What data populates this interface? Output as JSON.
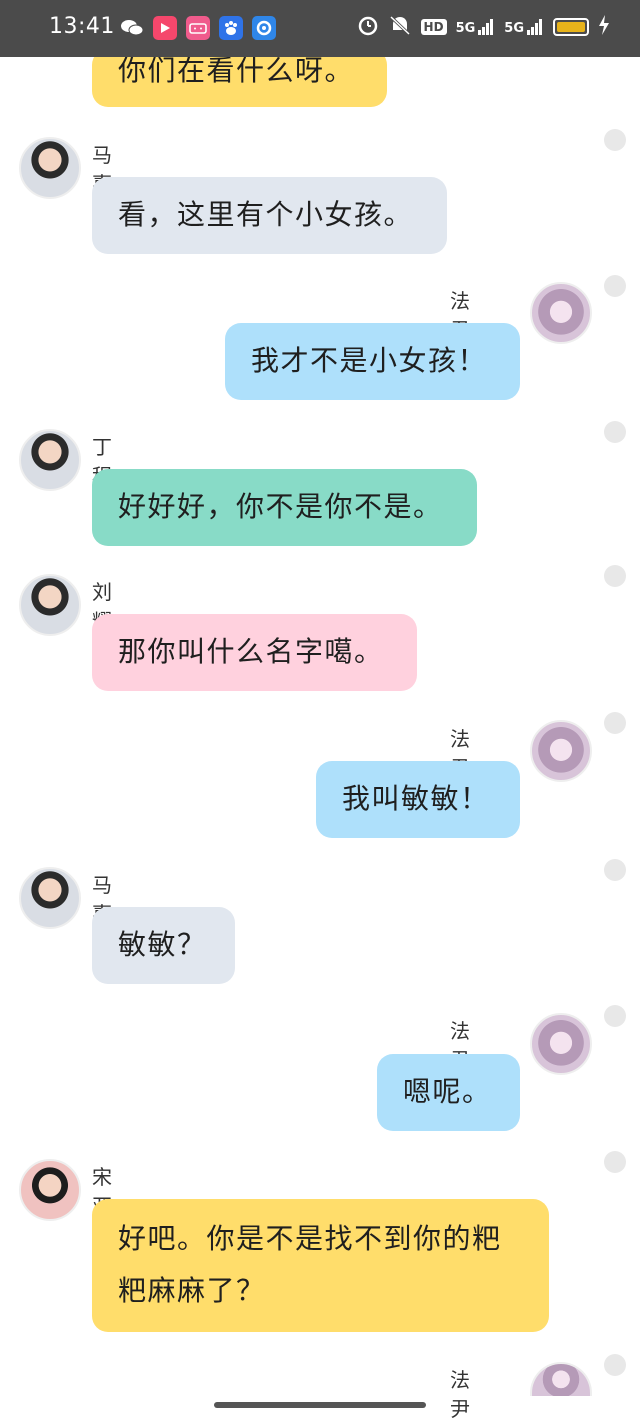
{
  "status_bar": {
    "time": "13:41",
    "left_icons": [
      "wechat-icon",
      "video-app-icon",
      "bilibili-icon",
      "baidu-icon",
      "browser-icon"
    ],
    "right_icons": [
      "alarm-icon",
      "mute-icon",
      "hd-icon",
      "5g-signal-icon",
      "5g-signal-icon",
      "battery-icon",
      "charging-icon"
    ],
    "hd_label": "HD",
    "network_1": "5G",
    "network_2": "5G",
    "battery_color": "#e8b31a"
  },
  "colors": {
    "yellow": "#ffdd6b",
    "grey": "#e1e7ef",
    "blue": "#aee0fb",
    "green": "#88dbc7",
    "pink": "#ffd1de"
  },
  "messages": [
    {
      "sender": "",
      "text": "你们在看什么呀。",
      "side": "right",
      "color": "yellow"
    },
    {
      "sender": "马嘉祺",
      "text": "看，这里有个小女孩。",
      "side": "left",
      "color": "grey"
    },
    {
      "sender": "法尹敏",
      "text": "我才不是小女孩！",
      "side": "right",
      "color": "blue"
    },
    {
      "sender": "丁程鑫",
      "text": "好好好，你不是你不是。",
      "side": "left",
      "color": "green"
    },
    {
      "sender": "刘耀文",
      "text": "那你叫什么名字噶。",
      "side": "left",
      "color": "pink"
    },
    {
      "sender": "法尹敏",
      "text": "我叫敏敏！",
      "side": "right",
      "color": "blue"
    },
    {
      "sender": "马嘉祺",
      "text": "敏敏？",
      "side": "left",
      "color": "grey"
    },
    {
      "sender": "法尹敏",
      "text": "嗯呢。",
      "side": "right",
      "color": "blue"
    },
    {
      "sender": "宋亚轩",
      "text": "好吧。你是不是找不到你的粑粑麻麻了？",
      "side": "left",
      "color": "yellow"
    },
    {
      "sender": "法尹敏",
      "text": "",
      "side": "right",
      "color": "blue"
    }
  ]
}
